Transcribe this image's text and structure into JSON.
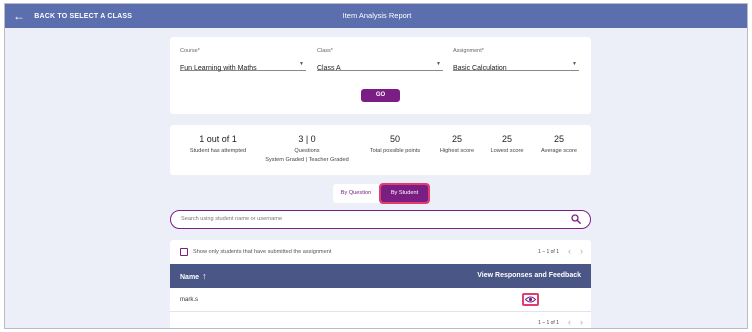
{
  "header": {
    "back_label": "BACK TO SELECT A CLASS",
    "title": "Item Analysis Report"
  },
  "filters": {
    "course": {
      "label": "Course*",
      "value": "Fun Learning with Maths"
    },
    "class": {
      "label": "Class*",
      "value": "Class A"
    },
    "assignment": {
      "label": "Assignment*",
      "value": "Basic Calculation"
    },
    "go_label": "GO"
  },
  "stats": [
    {
      "value": "1 out of 1",
      "label": "Student has attempted",
      "sublabel": ""
    },
    {
      "value": "3 | 0",
      "label": "Questions",
      "sublabel": "System Graded | Teacher Graded"
    },
    {
      "value": "50",
      "label": "Total possible points",
      "sublabel": ""
    },
    {
      "value": "25",
      "label": "Highest score",
      "sublabel": ""
    },
    {
      "value": "25",
      "label": "Lowest score",
      "sublabel": ""
    },
    {
      "value": "25",
      "label": "Average score",
      "sublabel": ""
    }
  ],
  "view_toggle": {
    "by_question": "By Question",
    "by_student": "By Student",
    "selected": "By Student"
  },
  "search": {
    "placeholder": "Search using student name or username"
  },
  "table": {
    "filter_label": "Show only students that have submitted the assignment",
    "pagination_top": "1 – 1 of 1",
    "pagination_bottom": "1 – 1 of 1",
    "columns": {
      "name": "Name",
      "action": "View Responses and Feedback"
    },
    "rows": [
      {
        "name": "mark.s"
      }
    ]
  },
  "icons": {
    "back": "arrow-left-icon",
    "search": "search-icon",
    "sort": "arrow-up-icon",
    "view": "eye-icon",
    "prev": "chevron-left-icon",
    "next": "chevron-right-icon"
  },
  "colors": {
    "header_bar": "#5b6faf",
    "table_header": "#4a5686",
    "primary": "#7b1e84",
    "highlight": "#e23d6d",
    "page_background": "#eceef8"
  }
}
